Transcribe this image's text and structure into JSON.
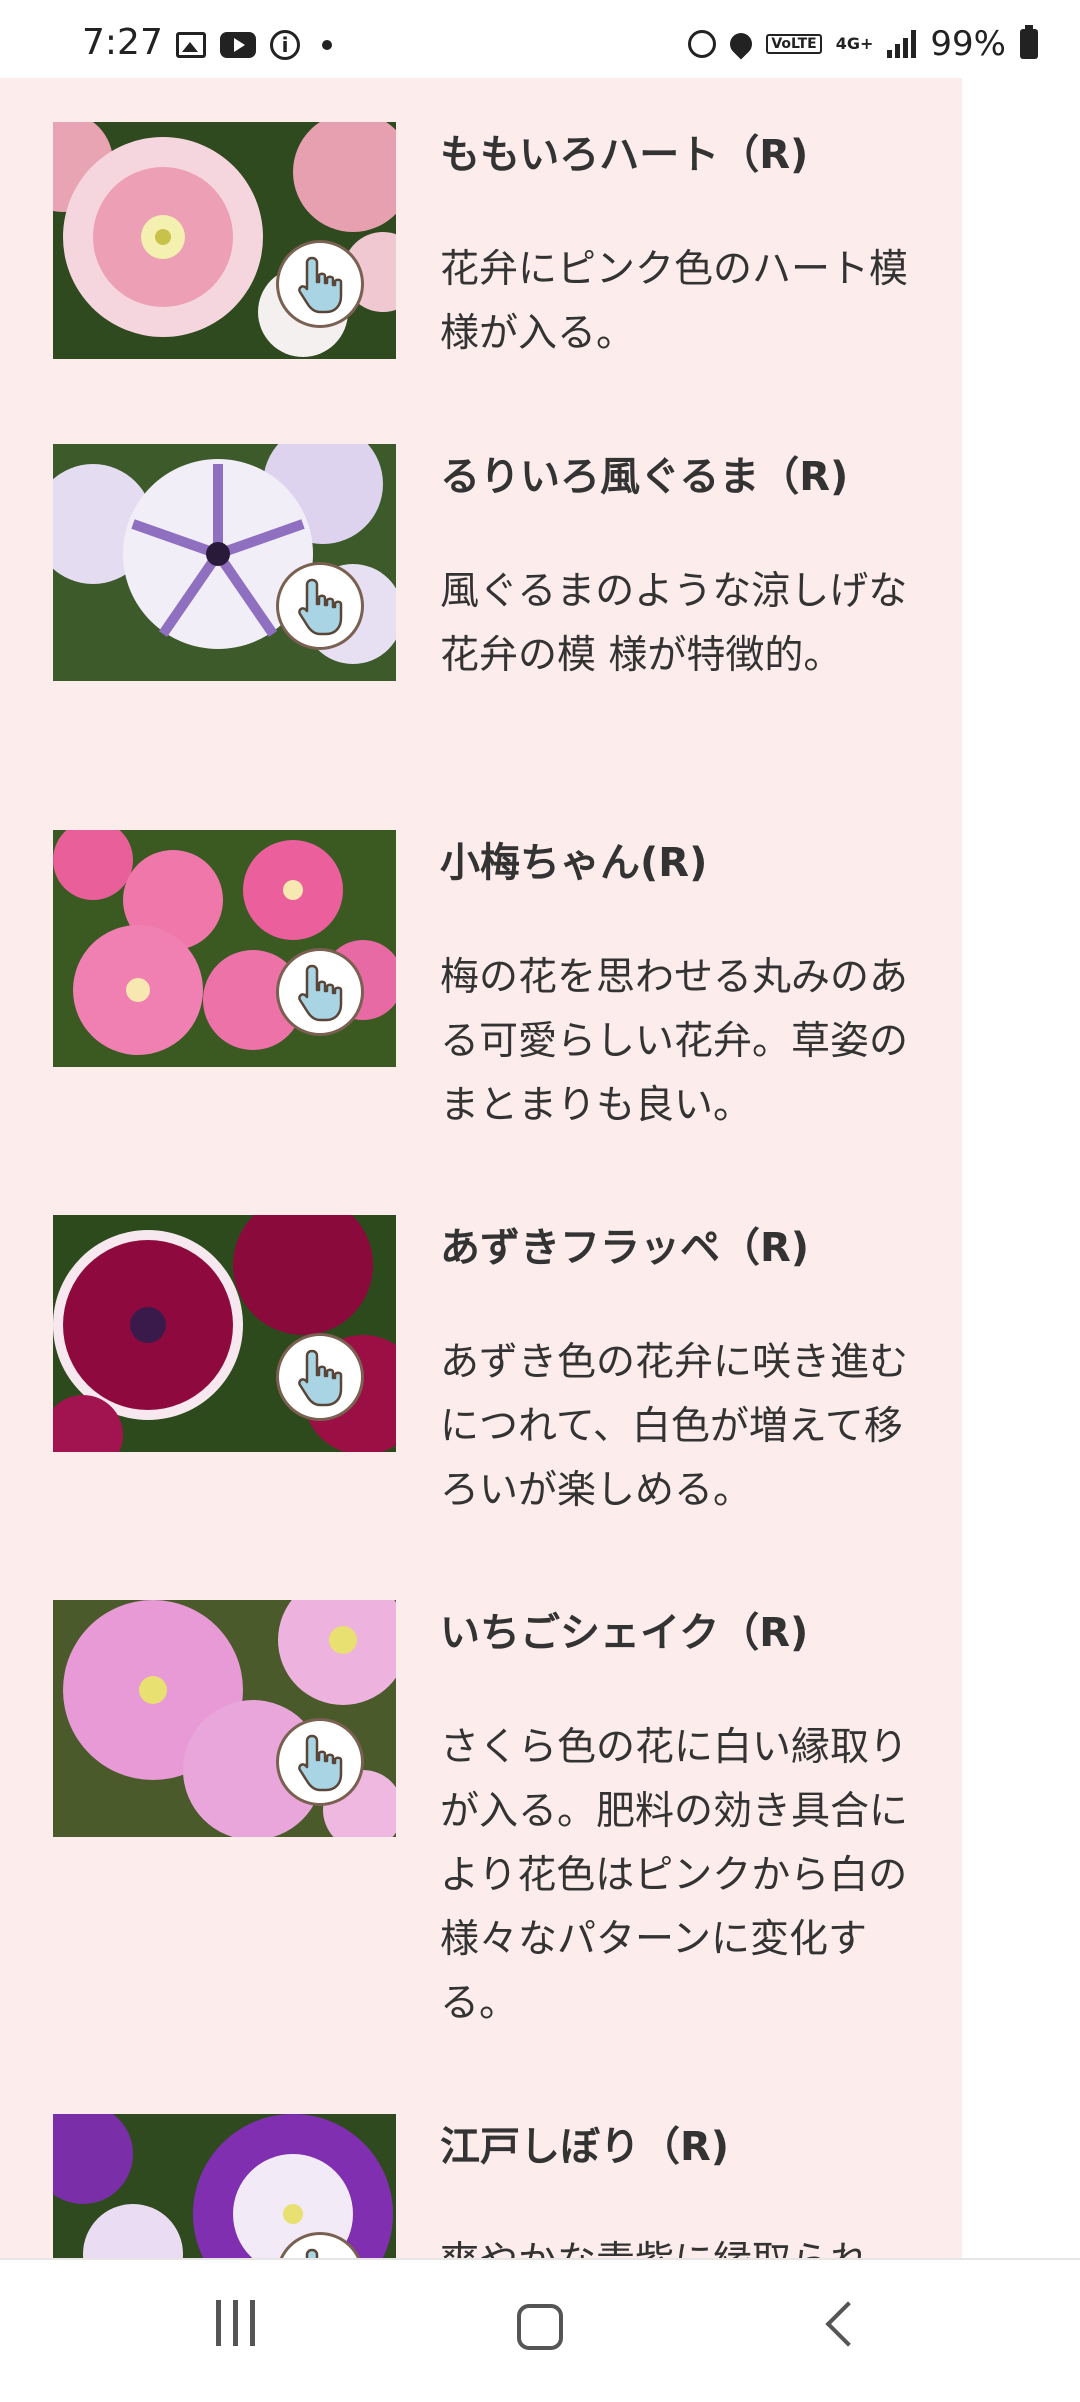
{
  "status_bar": {
    "time": "7:27",
    "left_icons": [
      "photo-icon",
      "youtube-icon",
      "info-icon",
      "dot-icon"
    ],
    "right_icons": [
      "alarm-icon",
      "location-icon",
      "volte-icon",
      "4g-icon",
      "signal-icon",
      "battery-icon"
    ],
    "volte": "VoLTE",
    "network": "4G+",
    "battery": "99%"
  },
  "items": [
    {
      "title": "ももいろハート（R)",
      "desc": "花弁にピンク色のハート模様が入る。"
    },
    {
      "title": "るりいろ風ぐるま（R)",
      "desc": "風ぐるまのような涼しげな花弁の模 様が特徴的。"
    },
    {
      "title": "小梅ちゃん(R)",
      "desc": "梅の花を思わせる丸みのある可愛らしい花弁。草姿のまとまりも良い。"
    },
    {
      "title": "あずきフラッペ（R)",
      "desc": "あずき色の花弁に咲き進むにつれて、白色が増えて移ろいが楽しめる。"
    },
    {
      "title": "いちごシェイク（R)",
      "desc": "さくら色の花に白い縁取りが入る。肥料の効き具合により花色はピンクから白の様々なパターンに変化する。"
    },
    {
      "title": "江戸しぼり（R)",
      "desc": "爽やかな青紫に縁取られ"
    }
  ],
  "colors": {
    "panel_bg": "#fcedec",
    "text": "#333333"
  }
}
